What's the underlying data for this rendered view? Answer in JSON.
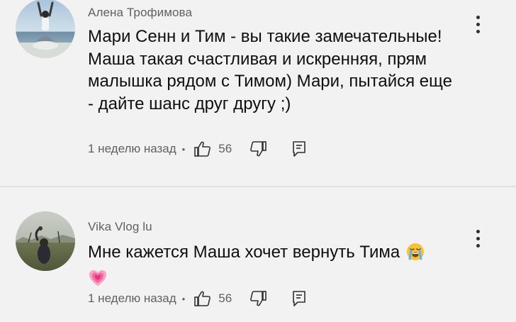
{
  "comments": [
    {
      "author": "Алена Трофимова",
      "text": "Мари Сенн и Тим - вы такие замечательные! Маша такая счастливая и искренняя, прям малышка рядом с Тимом) Мари, пытайся еще - дайте шанс друг другу ;)",
      "timestamp": "1 неделю назад",
      "bullet": "•",
      "likes": "56",
      "icons": {
        "avatar": "avatar-photo-person-beach",
        "like": "thumbs-up-icon",
        "dislike": "thumbs-down-icon",
        "reply": "reply-icon",
        "menu": "more-vert-icon"
      }
    },
    {
      "author": "Vika Vlog lu",
      "text": "Мне кажется Маша хочет вернуть Тима",
      "text_emojis": [
        "loudly-crying-face-emoji",
        "growing-heart-emoji"
      ],
      "timestamp": "1 неделю назад",
      "bullet": "•",
      "likes": "56",
      "icons": {
        "avatar": "avatar-photo-field",
        "like": "thumbs-up-icon",
        "dislike": "thumbs-down-icon",
        "reply": "reply-icon",
        "menu": "more-vert-icon"
      }
    }
  ],
  "colors": {
    "background": "#f2f2f2",
    "text": "#0f0f0f",
    "secondary_text": "#606060",
    "divider": "#e1e1e1"
  }
}
